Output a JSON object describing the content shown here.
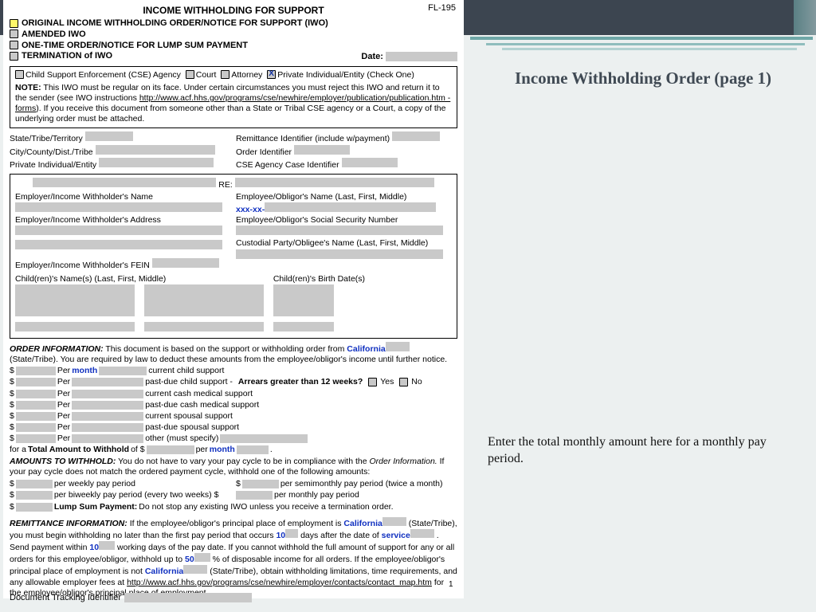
{
  "side": {
    "title": "Income Withholding Order (page 1)",
    "note": "Enter the total monthly amount here for a monthly pay period."
  },
  "form_code": "FL-195",
  "title": "INCOME WITHHOLDING FOR SUPPORT",
  "types": {
    "original": "ORIGINAL INCOME WITHHOLDING ORDER/NOTICE FOR SUPPORT (IWO)",
    "amended": "AMENDED IWO",
    "lump": "ONE-TIME ORDER/NOTICE FOR LUMP SUM PAYMENT",
    "term": "TERMINATION of IWO"
  },
  "date_label": "Date:",
  "filer": {
    "cse": "Child Support Enforcement (CSE) Agency",
    "court": "Court",
    "attorney": "Attorney",
    "priv": "Private Individual/Entity  (Check One)"
  },
  "note_label": "NOTE:",
  "note_text": "This IWO must be regular on its face. Under certain circumstances you must reject this IWO and return it to the sender (see IWO instructions ",
  "note_url": "http://www.acf.hhs.gov/programs/cse/newhire/employer/publication/publication.htm - forms",
  "note_text2": "). If you receive this document from someone other than a State or Tribal CSE agency or a Court, a copy of the underlying order must be attached.",
  "ids": {
    "state": "State/Tribe/Territory",
    "city": "City/County/Dist./Tribe",
    "priv": "Private Individual/Entity",
    "remit": "Remittance Identifier (include w/payment)",
    "order": "Order Identifier",
    "cse_case": "CSE Agency Case Identifier"
  },
  "parties": {
    "re": "RE:",
    "emp_name": "Employer/Income Withholder's Name",
    "emp_addr": "Employer/Income Withholder's Address",
    "fein": "Employer/Income Withholder's FEIN",
    "obl_name": "Employee/Obligor's Name (Last, First, Middle)",
    "ssn_prefix": "xxx-xx-",
    "obl_ssn": "Employee/Obligor's Social Security Number",
    "cust": "Custodial Party/Obligee's Name (Last, First, Middle)",
    "children": "Child(ren)'s Name(s) (Last, First, Middle)",
    "birth": "Child(ren)'s Birth Date(s)"
  },
  "order": {
    "heading": "ORDER INFORMATION:",
    "intro1": "This document is based on the support or withholding order from",
    "state_tribe": "(State/Tribe). You are required by law to deduct these amounts from the employee/obligor's income until further notice.",
    "state_value": "California",
    "per": "Per",
    "per_month": "month",
    "lines": {
      "ccs": "current child support",
      "past_ccs": "past-due child support -",
      "arrears_label": "Arrears greater than 12 weeks?",
      "yes": "Yes",
      "no": "No",
      "cms": "current cash medical support",
      "past_cms": "past-due cash medical support",
      "css": "current spousal support",
      "past_css": "past-due spousal support",
      "other": "other (must specify)"
    },
    "total_label": "Total Amount to Withhold",
    "total_per": "month"
  },
  "amounts": {
    "heading": "AMOUNTS TO WITHHOLD:",
    "intro": "You do not have to vary your pay cycle to be in compliance with the",
    "oi": "Order Information.",
    "intro2": "If your pay cycle does not match the ordered payment cycle, withhold one of the following amounts:",
    "weekly": "per weekly pay period",
    "biweekly": "per biweekly pay period (every two weeks) $",
    "semimonthly": "per semimonthly pay period (twice a month)",
    "monthly": "per monthly pay period",
    "lump_label": "Lump Sum Payment:",
    "lump_text": "Do not stop any existing IWO unless you receive a termination order."
  },
  "remit": {
    "heading": "REMITTANCE INFORMATION:",
    "t1": "If the employee/obligor's principal place of employment is",
    "state1": "California",
    "t2": "(State/Tribe), you must begin withholding no later than the first pay period that occurs",
    "days_val": "10",
    "t3": "days after the date of",
    "service": "service",
    "t4": ". Send payment within",
    "working_days": "10",
    "t5": "working days of the pay date. If you cannot withhold the full amount of support for any or all orders for this employee/obligor, withhold up to",
    "pct": "50",
    "t6": "% of disposable income for all orders. If the employee/obligor's principal place of employment is not",
    "state2": "California",
    "t7": "(State/Tribe), obtain withholding limitations, time requirements, and any allowable employer fees at",
    "url": "http://www.acf.hhs.gov/programs/cse/newhire/employer/contacts/contact_map.htm",
    "t8": "for the employee/obligor's principal place of employment."
  },
  "footer": {
    "page": "1",
    "tracking": "Document Tracking Identifier"
  }
}
